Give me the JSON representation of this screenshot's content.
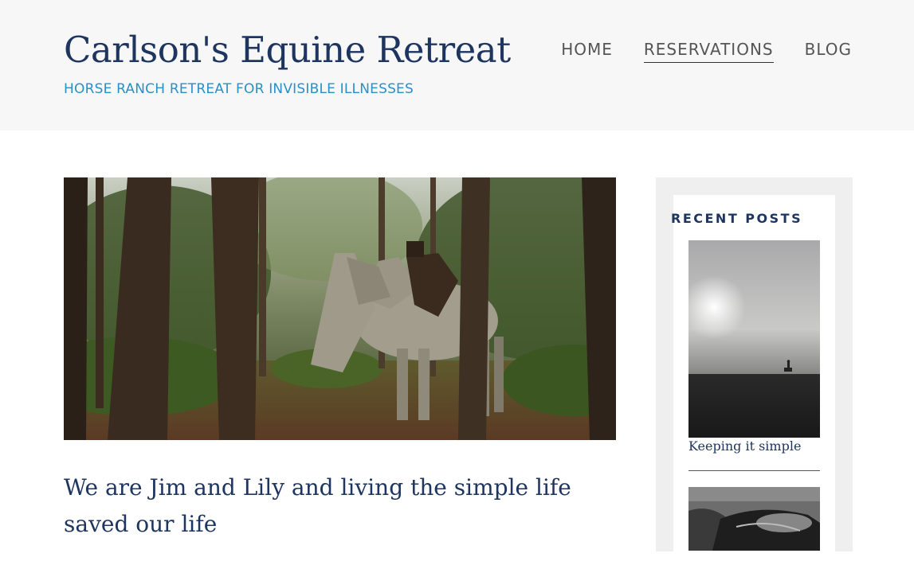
{
  "header": {
    "site_title": "Carlson's Equine Retreat",
    "tagline": "HORSE RANCH RETREAT FOR INVISIBLE ILLNESSES",
    "nav": [
      {
        "label": "HOME"
      },
      {
        "label": "RESERVATIONS"
      },
      {
        "label": "BLOG"
      }
    ],
    "active_nav": "RESERVATIONS"
  },
  "main": {
    "hero_image": "horse-in-forest-image",
    "post_title": "We are Jim and Lily and living the simple life saved our life"
  },
  "sidebar": {
    "widget_title": "RECENT POSTS",
    "posts": [
      {
        "title": "Keeping it simple",
        "image": "foggy-field-rider-image"
      },
      {
        "title": "",
        "image": "saddle-image"
      }
    ]
  },
  "colors": {
    "title_navy": "#1e3560",
    "tagline_blue": "#2a90c6",
    "header_bg": "#f7f7f7",
    "sidebar_bg": "#efefef"
  }
}
